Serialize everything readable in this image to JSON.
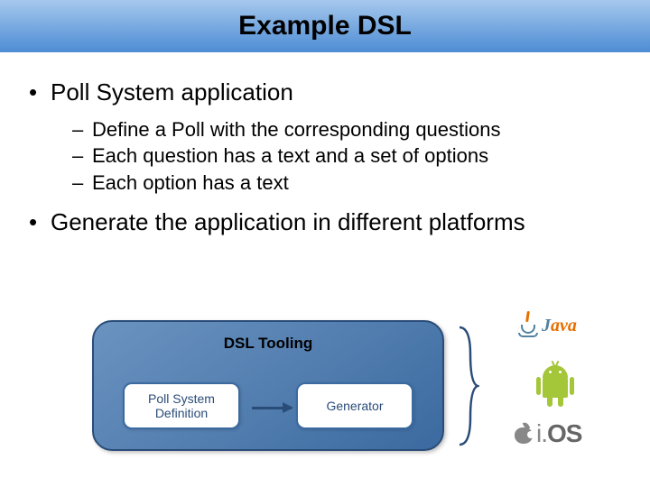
{
  "title": "Example DSL",
  "bullets": {
    "b1": {
      "text": "Poll System application",
      "sub": [
        "Define a Poll with the corresponding questions",
        "Each question has a text and a set of options",
        "Each option has a text"
      ]
    },
    "b2": {
      "text": "Generate the application in different platforms"
    }
  },
  "diagram": {
    "container_label": "DSL Tooling",
    "box_left": "Poll System Definition",
    "box_right": "Generator",
    "targets": {
      "java": "Java",
      "android": "Android",
      "ios": "iOS"
    }
  }
}
